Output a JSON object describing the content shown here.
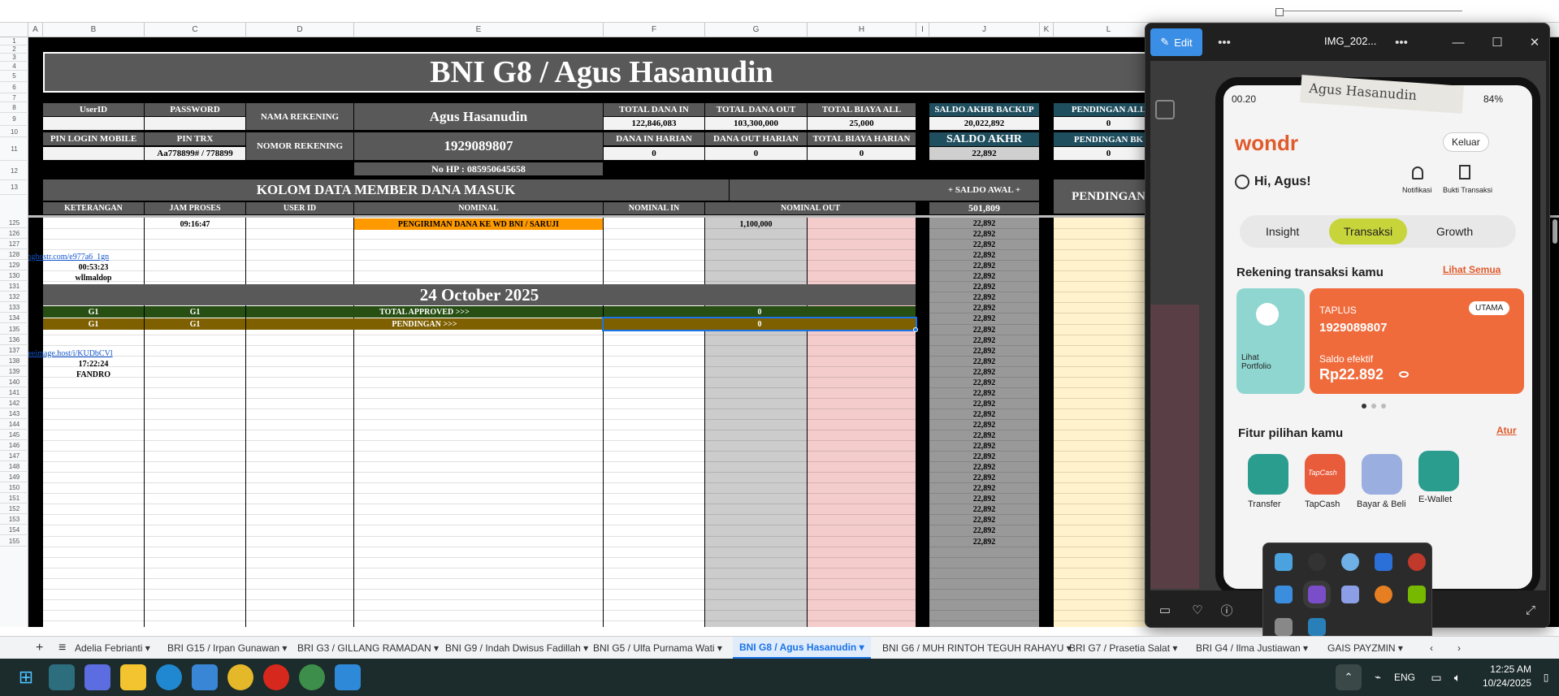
{
  "title": "BNI G8 / Agus Hasanudin",
  "columns": [
    "A",
    "B",
    "C",
    "D",
    "E",
    "F",
    "G",
    "H",
    "I",
    "J",
    "K",
    "L"
  ],
  "top_rows": [
    "1",
    "2",
    "3",
    "4",
    "5",
    "6",
    "7",
    "8",
    "9",
    "10",
    "11",
    "12",
    "13"
  ],
  "body_rows": [
    "125",
    "126",
    "127",
    "128",
    "129",
    "130",
    "131",
    "132",
    "133",
    "134",
    "135",
    "136",
    "137",
    "138",
    "139",
    "140",
    "141",
    "142",
    "143",
    "144",
    "145",
    "146",
    "147",
    "148",
    "149",
    "150",
    "151",
    "152",
    "153",
    "154",
    "155"
  ],
  "info": {
    "userid_label": "UserID",
    "password_label": "PASSWORD",
    "nama_rek_label": "NAMA REKENING",
    "nama_rek_value": "Agus Hasanudin",
    "total_in_label": "TOTAL DANA IN",
    "total_in_value": "122,846,083",
    "total_out_label": "TOTAL DANA OUT",
    "total_out_value": "103,300,000",
    "total_biaya_label": "TOTAL BIAYA ALL",
    "total_biaya_value": "25,000",
    "saldo_backup_label": "SALDO AKHR BACKUP",
    "saldo_backup_value": "20,022,892",
    "pending_all_label": "PENDINGAN ALL",
    "pending_all_value": "0",
    "pin_login_label": "PIN LOGIN MOBILE",
    "pin_trx_label": "PIN TRX",
    "pin_trx_value": "Aa778899# / 778899",
    "nomor_rek_label": "NOMOR REKENING",
    "nomor_rek_value": "1929089807",
    "dana_in_harian_label": "DANA IN HARIAN",
    "dana_in_harian_value": "0",
    "dana_out_harian_label": "DANA OUT HARIAN",
    "dana_out_harian_value": "0",
    "biaya_harian_label": "TOTAL BIAYA HARIAN",
    "biaya_harian_value": "0",
    "saldo_akhr_label": "SALDO AKHR",
    "saldo_akhr_value": "22,892",
    "pending_bk_label": "PENDINGAN BK",
    "pending_bk_value": "0",
    "no_hp": "No HP : 085950645658"
  },
  "kolom": {
    "title": "KOLOM DATA MEMBER DANA MASUK",
    "saldo_awal_label": "+ SALDO AWAL +",
    "saldo_awal_value": "501,809",
    "pendingan": "PENDINGAN",
    "headers": [
      "KETERANGAN",
      "JAM PROSES",
      "USER ID",
      "NOMINAL",
      "NOMINAL IN",
      "NOMINAL OUT"
    ]
  },
  "entries": {
    "jam_125": "09:16:47",
    "nominal_125": "PENGIRIMAN DANA KE WD BNI  / SARUJI",
    "out_125": "1,100,000",
    "link_128": "https://imghostr.com/e977a6_1gn",
    "time_129": "00:53:23",
    "name_130": "wllmaldop",
    "date_131": "24 October 2025",
    "g1": "G1",
    "approved_label": "TOTAL APPROVED >>>",
    "approved_value": "0",
    "pending_label": "PENDINGAN >>>",
    "pending_value": "0",
    "link_137": "https://freeimage.host/i/KUDbCVl",
    "time_138": "17:22:24",
    "name_139": "FANDRO"
  },
  "saldo_values": [
    "22,892",
    "22,892",
    "22,892",
    "22,892",
    "22,892",
    "22,892",
    "22,892",
    "22,892",
    "22,892",
    "22,892",
    "22,892",
    "22,892",
    "22,892",
    "22,892",
    "22,892",
    "22,892",
    "22,892",
    "22,892",
    "22,892",
    "22,892",
    "22,892",
    "22,892",
    "22,892",
    "22,892",
    "22,892",
    "22,892",
    "22,892",
    "22,892",
    "22,892",
    "22,892",
    "22,892"
  ],
  "viewer": {
    "edit_label": "Edit",
    "filename": "IMG_202...",
    "phone": {
      "status_time": "00.20",
      "battery": "84%",
      "note": "Agus Hasanudin",
      "brand": "wondr",
      "logout": "Keluar",
      "greeting": "Hi, Agus!",
      "notif": "Notifikasi",
      "bukti": "Bukti Transaksi",
      "tabs": [
        "Insight",
        "Transaksi",
        "Growth"
      ],
      "rek_title": "Rekening transaksi kamu",
      "lihat_semua": "Lihat Semua",
      "lihat_portfolio": "Lihat Portfolio",
      "acct_type": "TAPLUS",
      "utama": "UTAMA",
      "acct_no": "1929089807",
      "saldo_label": "Saldo efektif",
      "saldo_value": "Rp22.892",
      "fitur_title": "Fitur pilihan kamu",
      "atur": "Atur",
      "fitur": [
        "Transfer",
        "TapCash",
        "Bayar & Beli",
        "E-Wallet"
      ],
      "tapcash_logo": "TapCash"
    }
  },
  "tabs": {
    "add": "+",
    "menu": "≡",
    "items": [
      "Adelia Febrianti",
      "BRI G15 / Irpan Gunawan",
      "BRI G3 / GILLANG RAMADAN",
      "BNI G9 / Indah Dwisus Fadillah",
      "BNI G5 / Ulfa Purnama Wati",
      "BNI G8 / Agus Hasanudin",
      "BNI G6 / MUH RINTOH TEGUH RAHAYU",
      "BRI G7 / Prasetia Salat",
      "BRI G4 / Ilma Justiawan",
      "GAIS PAYZMIN"
    ],
    "active": "BNI G8 / Agus Hasanudin"
  },
  "taskbar": {
    "lang": "ENG",
    "time": "12:25 AM",
    "date": "10/24/2025"
  },
  "colors": {
    "header_gray": "#595959",
    "teal": "#1f4e5f",
    "orange": "#ff9900",
    "green": "#274e13",
    "olive": "#7f6000",
    "pink": "#f4cccc",
    "light_gray": "#cccccc",
    "yellow": "#fff2cc",
    "saldo_col": "#999999",
    "accent_blue": "#1a73e8"
  }
}
